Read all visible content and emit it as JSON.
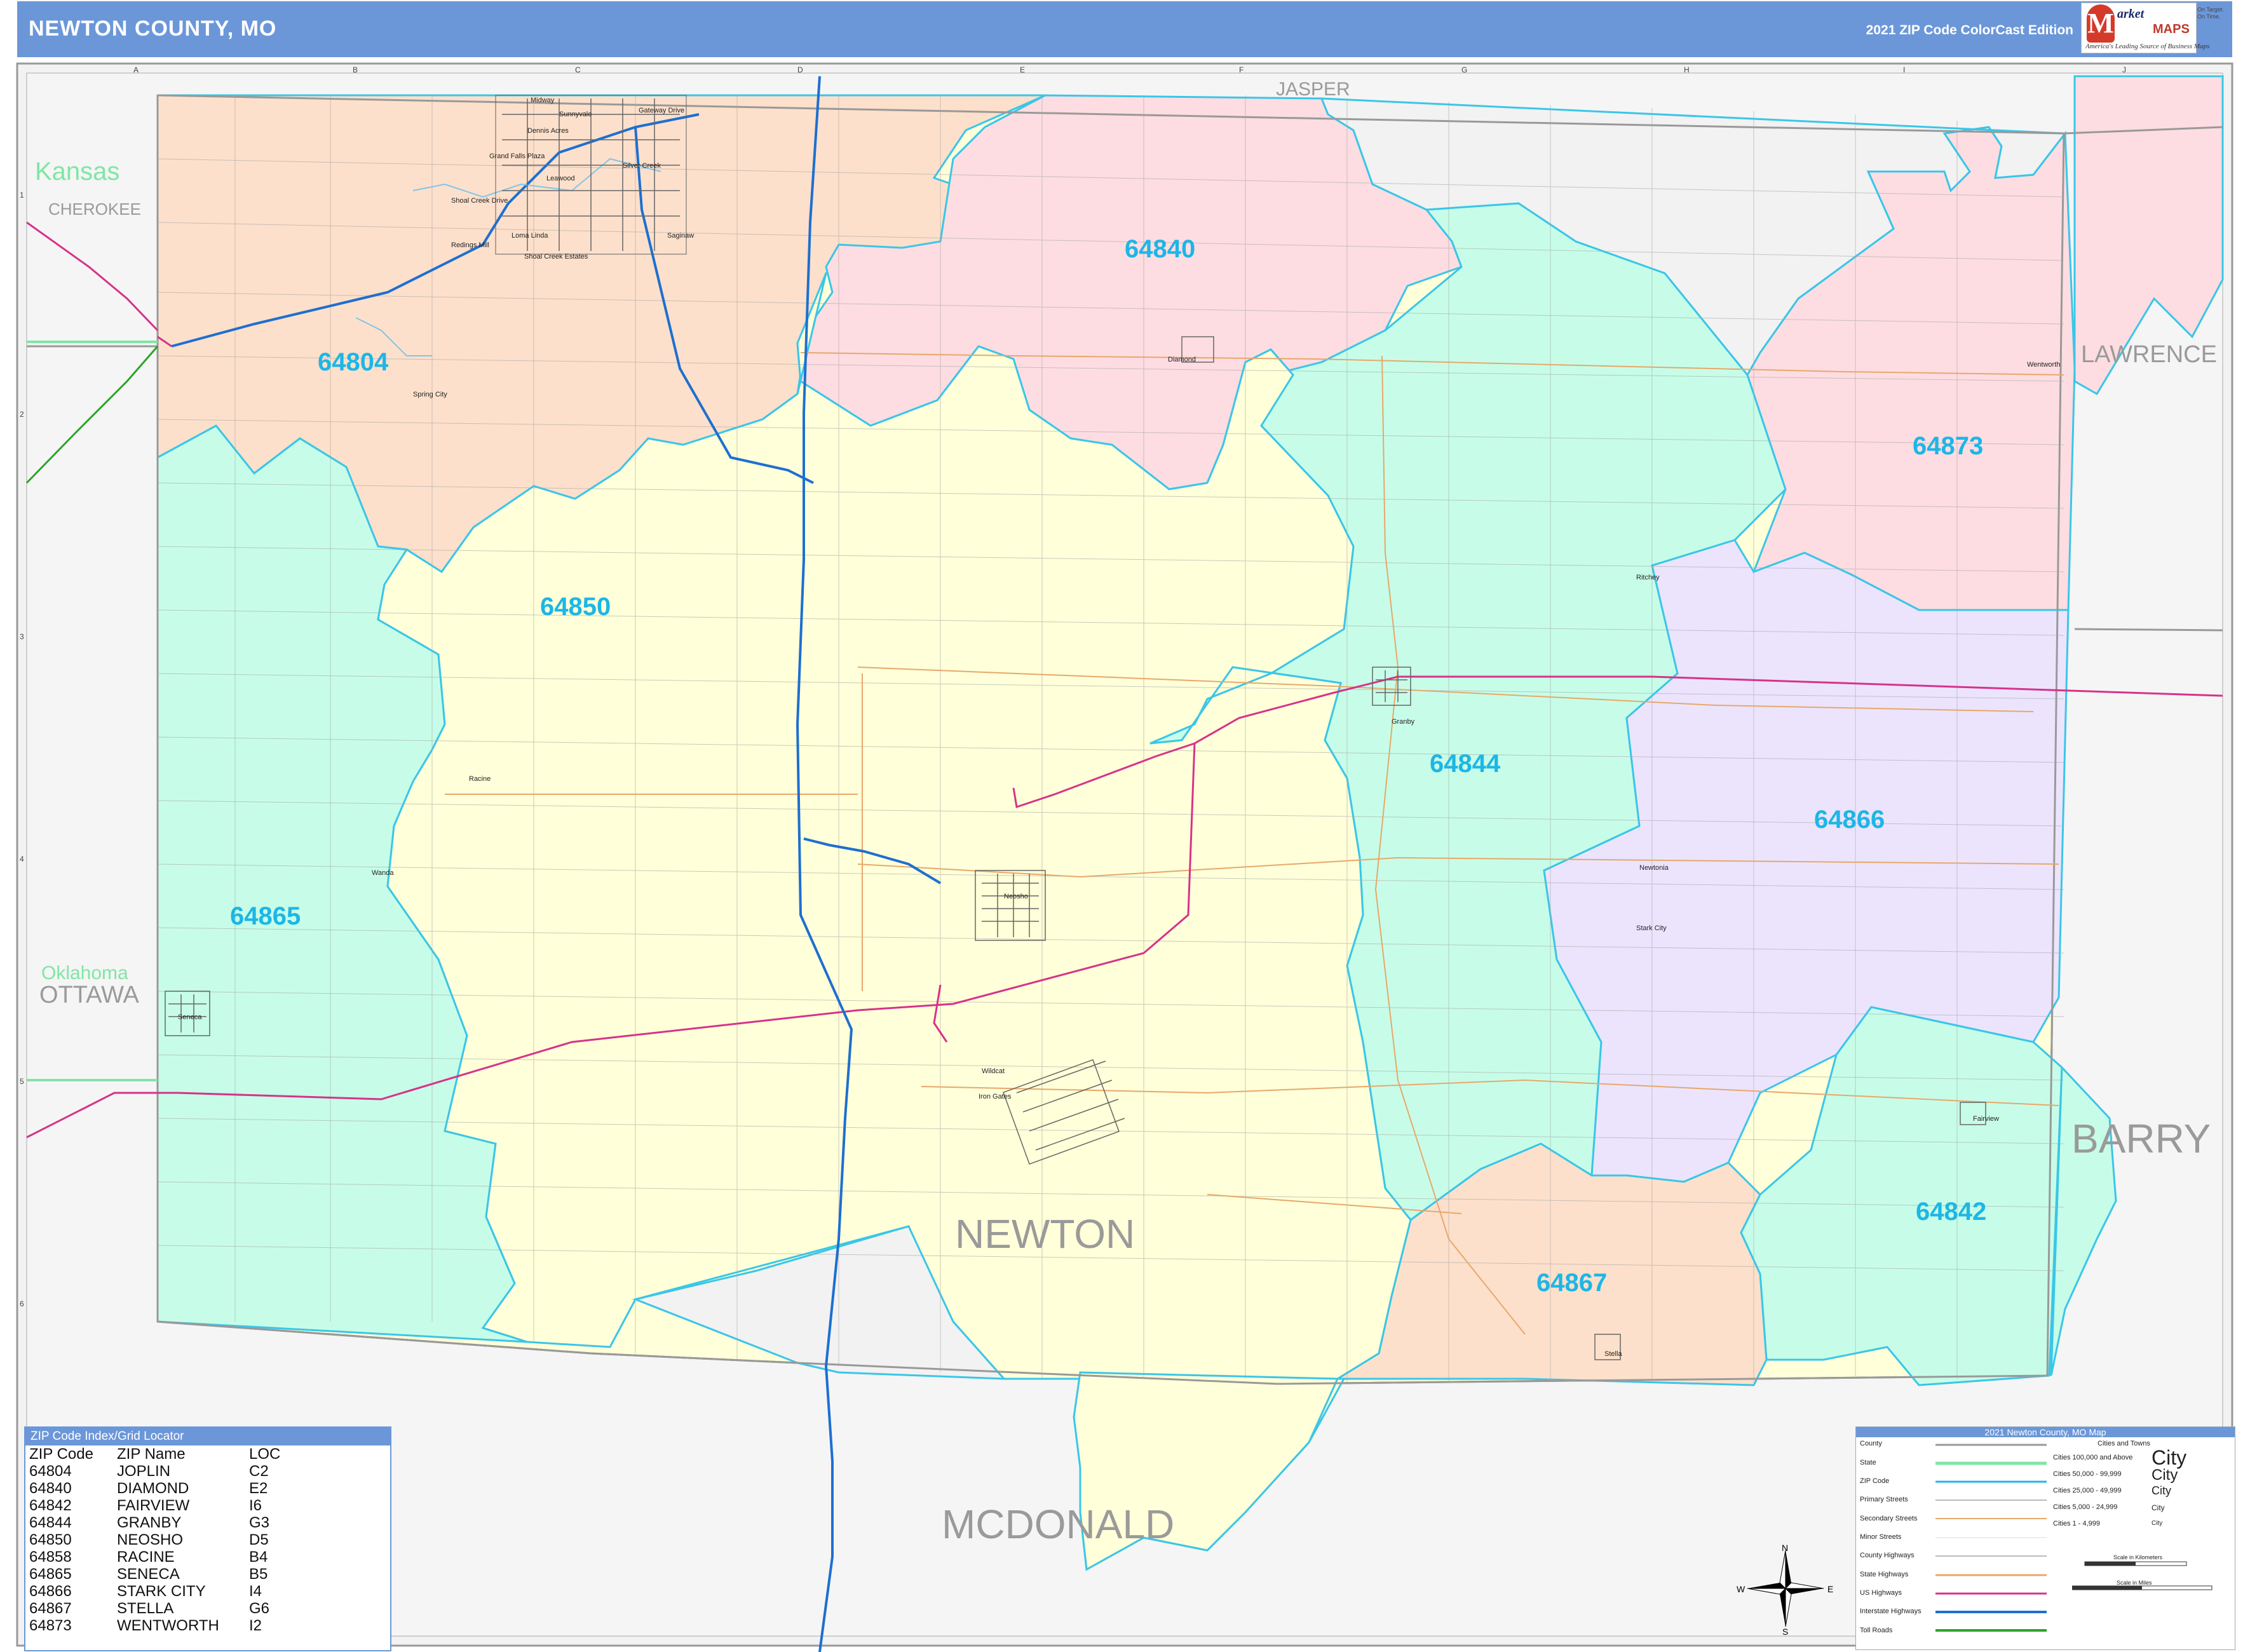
{
  "header": {
    "title": "NEWTON COUNTY, MO",
    "edition": "2021 ZIP Code ColorCast Edition",
    "logo_line1": "arket",
    "logo_line2": "MAPS",
    "logo_tagline": "America's Leading Source of Business Maps",
    "logo_slogan": "On Target. On Time."
  },
  "grid": {
    "columns": [
      "A",
      "B",
      "C",
      "D",
      "E",
      "F",
      "G",
      "H",
      "I",
      "J"
    ],
    "rows": [
      "1",
      "2",
      "3",
      "4",
      "5",
      "6"
    ]
  },
  "colors": {
    "zip_label": "#1db6e6",
    "orange_zone": "#fde0cb",
    "pink_zone": "#fddde2",
    "green_zone": "#c7fde8",
    "yellow_zone": "#ffffd9",
    "purple_zone": "#ece4fd",
    "outside_gray": "#f2f2f2",
    "us_highway": "#d6338a",
    "interstate": "#1e6fd0",
    "state_line": "#7fe6a4",
    "toll_road": "#2aa52a"
  },
  "zip_labels": [
    {
      "zip": "64804"
    },
    {
      "zip": "64840"
    },
    {
      "zip": "64873"
    },
    {
      "zip": "64850"
    },
    {
      "zip": "64844"
    },
    {
      "zip": "64866"
    },
    {
      "zip": "64865"
    },
    {
      "zip": "64842"
    },
    {
      "zip": "64867"
    }
  ],
  "county_labels": {
    "jasper": "JASPER",
    "lawrence": "LAWRENCE",
    "barry": "BARRY",
    "newton": "NEWTON",
    "mcdonald": "MCDONALD",
    "cherokee": "CHEROKEE",
    "ottawa": "OTTAWA"
  },
  "state_labels": {
    "kansas": "Kansas",
    "oklahoma": "Oklahoma"
  },
  "towns": [
    {
      "name": "Diamond"
    },
    {
      "name": "Granby"
    },
    {
      "name": "Neosho"
    },
    {
      "name": "Racine"
    },
    {
      "name": "Seneca"
    },
    {
      "name": "Stark City"
    },
    {
      "name": "Stella"
    },
    {
      "name": "Fairview"
    },
    {
      "name": "Wentworth"
    },
    {
      "name": "Newtonia"
    },
    {
      "name": "Ritchey"
    },
    {
      "name": "Redings Mill"
    },
    {
      "name": "Saginaw"
    },
    {
      "name": "Leawood"
    },
    {
      "name": "Dennis Acres"
    },
    {
      "name": "Silver Creek"
    },
    {
      "name": "Shoal Creek Drive"
    },
    {
      "name": "Shoal Creek Estates"
    },
    {
      "name": "Loma Linda"
    },
    {
      "name": "Grand Falls Plaza"
    },
    {
      "name": "Midway"
    },
    {
      "name": "Gateway Drive"
    },
    {
      "name": "Sunnyvale"
    },
    {
      "name": "Spring City"
    },
    {
      "name": "Wanda"
    },
    {
      "name": "Wildcat"
    },
    {
      "name": "Iron Gates"
    }
  ],
  "index": {
    "title": "ZIP Code Index/Grid Locator",
    "columns": [
      "ZIP Code",
      "ZIP Name",
      "LOC"
    ],
    "rows": [
      [
        "64804",
        "JOPLIN",
        "C2"
      ],
      [
        "64840",
        "DIAMOND",
        "E2"
      ],
      [
        "64842",
        "FAIRVIEW",
        "I6"
      ],
      [
        "64844",
        "GRANBY",
        "G3"
      ],
      [
        "64850",
        "NEOSHO",
        "D5"
      ],
      [
        "64858",
        "RACINE",
        "B4"
      ],
      [
        "64865",
        "SENECA",
        "B5"
      ],
      [
        "64866",
        "STARK CITY",
        "I4"
      ],
      [
        "64867",
        "STELLA",
        "G6"
      ],
      [
        "64873",
        "WENTWORTH",
        "I2"
      ]
    ]
  },
  "legend": {
    "title": "2021 Newton County, MO Map",
    "items": [
      "County",
      "State",
      "ZIP Code",
      "Primary Streets",
      "Secondary Streets",
      "Minor Streets",
      "County Highways",
      "State Highways",
      "US Highways",
      "Interstate Highways",
      "Toll Roads"
    ],
    "cities_title": "Cities and Towns",
    "city_classes": [
      "Cities 100,000 and Above",
      "Cities 50,000 - 99,999",
      "Cities 25,000 - 49,999",
      "Cities 5,000 - 24,999",
      "Cities 1 - 4,999"
    ],
    "city_sample": "City",
    "scale_km": "Scale in Kilometers",
    "scale_mi": "Scale in Miles",
    "compass": {
      "n": "N",
      "s": "S",
      "e": "E",
      "w": "W"
    }
  }
}
